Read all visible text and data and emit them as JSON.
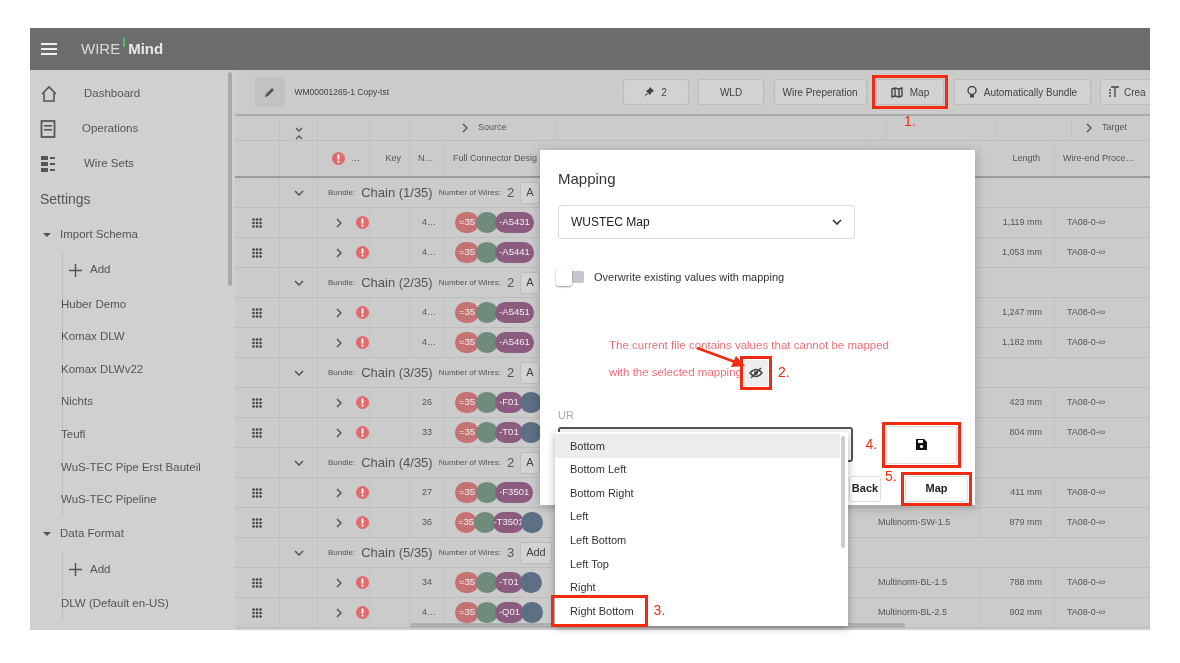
{
  "app": {
    "logo_left": "WIRE",
    "logo_right": "Mind"
  },
  "sidebar": {
    "nav": [
      {
        "label": "Dashboard"
      },
      {
        "label": "Operations"
      },
      {
        "label": "Wire Sets"
      }
    ],
    "settings_title": "Settings",
    "sections": [
      {
        "label": "Import Schema",
        "expanded": true,
        "add_label": "Add",
        "items": [
          "Huber Demo",
          "Komax DLW",
          "Komax DLWv22",
          "Nichts",
          "Teufl",
          "WuS-TEC Pipe Erst Bauteil",
          "WuS-TEC Pipeline"
        ]
      },
      {
        "label": "Data Format",
        "expanded": true,
        "add_label": "Add",
        "items": [
          "DLW (Default en-US)"
        ]
      }
    ]
  },
  "toolbar": {
    "document": "WM00001265-1 Copy-tst",
    "buttons": [
      {
        "label": "2"
      },
      {
        "label": "WLD"
      },
      {
        "label": "Wire Preperation"
      },
      {
        "label": "Map"
      },
      {
        "label": "Automatically Bundle"
      },
      {
        "label": "Crea"
      }
    ]
  },
  "table": {
    "column_groups": [
      {
        "label": "Source",
        "expanded": false
      },
      {
        "label": "Target",
        "expanded": false
      }
    ],
    "columns": [
      "…",
      "Key",
      "N…",
      "Full Connector Desig",
      "Length",
      "Wire-end Proce…"
    ],
    "groups": [
      {
        "bundle_label": "Bundle:",
        "name": "Chain (1/35)",
        "wires_label": "Number of Wires:",
        "wires": "2",
        "button": "A",
        "expanded": true,
        "rows": [
          {
            "n": "4…",
            "parts": [
              {
                "text": "=35",
                "color": "#c47273"
              },
              {
                "color": "#6f8b7c"
              },
              {
                "text": "-A5431",
                "color": "#8c5b80"
              }
            ],
            "length": "1,119 mm",
            "wire_end": "TA08-0-∞"
          },
          {
            "n": "4…",
            "parts": [
              {
                "text": "=35",
                "color": "#c47273"
              },
              {
                "color": "#6f8b7c"
              },
              {
                "text": "-A5441",
                "color": "#8c5b80"
              }
            ],
            "length": "1,053 mm",
            "wire_end": "TA08-0-∞"
          }
        ]
      },
      {
        "bundle_label": "Bundle:",
        "name": "Chain (2/35)",
        "wires_label": "Number of Wires:",
        "wires": "2",
        "button": "A",
        "expanded": true,
        "rows": [
          {
            "n": "4…",
            "parts": [
              {
                "text": "=35",
                "color": "#c47273"
              },
              {
                "color": "#6f8b7c"
              },
              {
                "text": "-A5451",
                "color": "#8c5b80"
              }
            ],
            "length": "1,247 mm",
            "wire_end": "TA08-0-∞"
          },
          {
            "n": "4…",
            "parts": [
              {
                "text": "=35",
                "color": "#c47273"
              },
              {
                "color": "#6f8b7c"
              },
              {
                "text": "-A5461",
                "color": "#8c5b80"
              }
            ],
            "length": "1,182 mm",
            "wire_end": "TA08-0-∞"
          }
        ]
      },
      {
        "bundle_label": "Bundle:",
        "name": "Chain (3/35)",
        "wires_label": "Number of Wires:",
        "wires": "2",
        "button": "A",
        "expanded": true,
        "rows": [
          {
            "n": "26",
            "parts": [
              {
                "text": "=35",
                "color": "#c47273"
              },
              {
                "color": "#6f8b7c"
              },
              {
                "text": "-F01",
                "color": "#8c5b80"
              },
              {
                "color": "#5d6f83"
              }
            ],
            "length": "423 mm",
            "wire_end": "TA08-0-∞"
          },
          {
            "n": "33",
            "parts": [
              {
                "text": "=35",
                "color": "#c47273"
              },
              {
                "color": "#6f8b7c"
              },
              {
                "text": "-T01",
                "color": "#8c5b80"
              },
              {
                "color": "#5d6f83"
              }
            ],
            "length": "804 mm",
            "wire_end": "TA08-0-∞"
          }
        ]
      },
      {
        "bundle_label": "Bundle:",
        "name": "Chain (4/35)",
        "wires_label": "Number of Wires:",
        "wires": "2",
        "button": "A",
        "expanded": true,
        "rows": [
          {
            "n": "27",
            "parts": [
              {
                "text": "=35",
                "color": "#c47273"
              },
              {
                "color": "#6f8b7c"
              },
              {
                "text": "-F3501",
                "color": "#8c5b80"
              }
            ],
            "length": "411 mm",
            "wire_end": "TA08-0-∞"
          },
          {
            "n": "36",
            "parts": [
              {
                "text": "=35",
                "color": "#c47273"
              },
              {
                "color": "#6f8b7c"
              },
              {
                "text": "-T3501",
                "color": "#8c5b80"
              },
              {
                "color": "#5d6f83"
              }
            ],
            "product": "Multinorm-SW-1.5",
            "length": "879 mm",
            "wire_end": "TA08-0-∞"
          }
        ]
      },
      {
        "bundle_label": "Bundle:",
        "name": "Chain (5/35)",
        "wires_label": "Number of Wires:",
        "wires": "3",
        "button": "Add",
        "expanded": true,
        "rows": [
          {
            "n": "34",
            "parts": [
              {
                "text": "=35",
                "color": "#c47273"
              },
              {
                "color": "#6f8b7c"
              },
              {
                "text": "-T01",
                "color": "#8c5b80"
              },
              {
                "color": "#5d6f83"
              }
            ],
            "product": "Multinorm-BL-1.5",
            "length": "788 mm",
            "wire_end": "TA08-0-∞"
          },
          {
            "n": "4…",
            "parts": [
              {
                "text": "=35",
                "color": "#c47273"
              },
              {
                "color": "#6f8b7c"
              },
              {
                "text": "-Q01",
                "color": "#8c5b80"
              },
              {
                "color": "#5d6f83"
              }
            ],
            "product": "Multinorm-BL-2.5",
            "length": "902 mm",
            "wire_end": "TA08-0-∞"
          }
        ]
      }
    ]
  },
  "dialog": {
    "title": "Mapping",
    "mapping_select": "WUSTEC Map",
    "overwrite": {
      "label": "Overwrite existing values with mapping",
      "on": false
    },
    "warning": [
      "The current file contains values that cannot be mapped",
      "with the selected mapping"
    ],
    "field_label": "UR",
    "options": [
      {
        "label": "Bottom",
        "selected": true
      },
      {
        "label": "Bottom Left",
        "selected": false
      },
      {
        "label": "Bottom Right",
        "selected": false
      },
      {
        "label": "Left",
        "selected": false
      },
      {
        "label": "Left Bottom",
        "selected": false
      },
      {
        "label": "Left Top",
        "selected": false
      },
      {
        "label": "Right",
        "selected": false
      },
      {
        "label": "Right Bottom",
        "selected": false
      }
    ],
    "buttons": [
      "Back",
      "Map"
    ]
  },
  "annotations": [
    {
      "label": "1."
    },
    {
      "label": "2."
    },
    {
      "label": "3."
    },
    {
      "label": "4."
    },
    {
      "label": "5."
    }
  ]
}
